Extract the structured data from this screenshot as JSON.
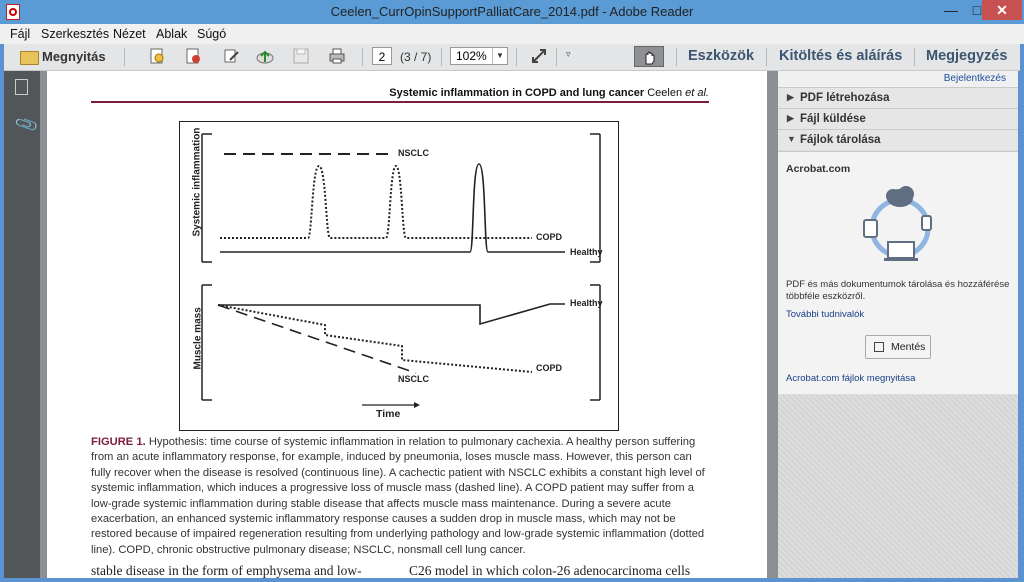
{
  "window": {
    "title": "Ceelen_CurrOpinSupportPalliatCare_2014.pdf - Adobe Reader"
  },
  "menu": [
    "Fájl",
    "Szerkesztés",
    "Nézet",
    "Ablak",
    "Súgó"
  ],
  "toolbar": {
    "open_label": "Megnyitás",
    "page_value": "2",
    "page_count": "(3 / 7)",
    "zoom_value": "102%",
    "tools_label": "Eszközök",
    "fill_sign_label": "Kitöltés és aláírás",
    "comment_label": "Megjegyzés"
  },
  "document": {
    "running_head_bold": "Systemic inflammation in COPD and lung cancer",
    "running_head_authors": "Ceelen",
    "running_head_etal": "et al.",
    "figure": {
      "top_ylabel": "Systemic inflammation",
      "bottom_ylabel": "Muscle mass",
      "xlabel": "Time",
      "top_labels": {
        "nsclc": "NSCLC",
        "copd": "COPD",
        "healthy": "Healthy"
      },
      "bottom_labels": {
        "healthy": "Healthy",
        "copd": "COPD",
        "nsclc": "NSCLC"
      }
    },
    "caption_label": "FIGURE 1.",
    "caption_text": "Hypothesis: time course of systemic inflammation in relation to pulmonary cachexia. A healthy person suffering from an acute inflammatory response, for example, induced by pneumonia, loses muscle mass. However, this person can fully recover when the disease is resolved (continuous line). A cachectic patient with NSCLC exhibits a constant high level of systemic inflammation, which induces a progressive loss of muscle mass (dashed line). A COPD patient may suffer from a low-grade systemic inflammation during stable disease that affects muscle mass maintenance. During a severe acute exacerbation, an enhanced systemic inflammatory response causes a sudden drop in muscle mass, which may not be restored because of impaired regeneration resulting from underlying pathology and low-grade systemic inflammation (dotted line). COPD, chronic obstructive pulmonary disease; NSCLC, nonsmall cell lung cancer.",
    "body_left": "stable disease in the form of emphysema and low-",
    "body_right": "C26 model in which colon-26 adenocarcinoma cells"
  },
  "right_panel": {
    "login": "Bejelentkezés",
    "sections": [
      "PDF létrehozása",
      "Fájl küldése",
      "Fájlok tárolása"
    ],
    "acrobat_heading": "Acrobat.com",
    "description": "PDF és más dokumentumok tárolása és hozzáférése többféle eszközről.",
    "more_link": "További tudnivalók",
    "save_button": "Mentés",
    "open_files_link": "Acrobat.com fájlok megnyitása"
  }
}
